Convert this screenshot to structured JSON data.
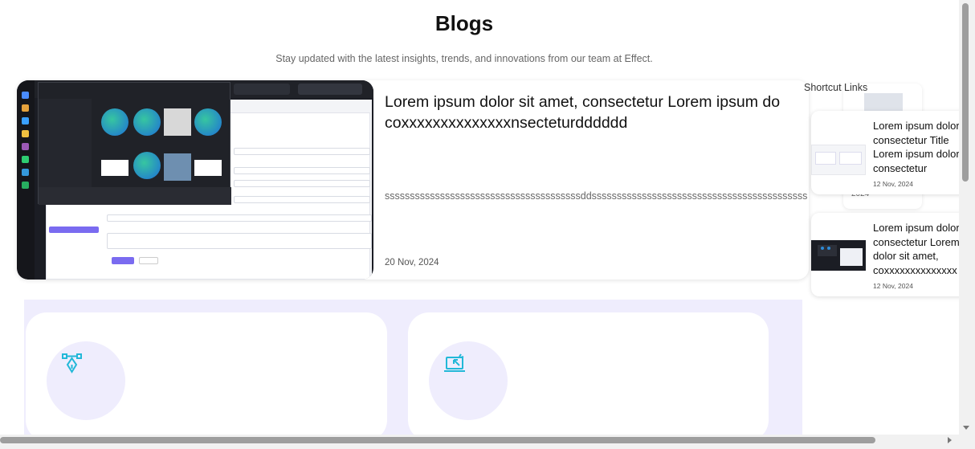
{
  "page": {
    "title": "Blogs",
    "subtitle": "Stay updated with the latest insights, trends, and innovations from our team at Effect."
  },
  "featured": {
    "title_line1": "Lorem ipsum dolor sit amet, consectetur Lorem ipsum do",
    "title_line2": "coxxxxxxxxxxxxxxnsecteturdddddd",
    "excerpt": "sssssssssssssssssssssssssssssssssssssssddsssssssssssssssssssssssssssssssssssssssssss",
    "date": "20 Nov, 2024"
  },
  "sidebar": {
    "heading": "Shortcut Links",
    "ghost_year": "2024",
    "cards": [
      {
        "title_lines": [
          "Lorem ipsum dolor",
          "consectetur Title",
          "Lorem ipsum dolor",
          "consectetur"
        ],
        "date": "12 Nov, 2024"
      },
      {
        "title_lines": [
          "Lorem ipsum dolor",
          "consectetur Lorem",
          "dolor sit amet,",
          "coxxxxxxxxxxxxxx"
        ],
        "date": "12 Nov, 2024"
      }
    ]
  },
  "services": [
    {
      "icon": "vector-pen-icon"
    },
    {
      "icon": "laptop-cursor-icon"
    }
  ],
  "colors": {
    "accent": "#7a6bf0",
    "lavender_bg": "#efedfd",
    "icon_cyan": "#22b8d8"
  }
}
